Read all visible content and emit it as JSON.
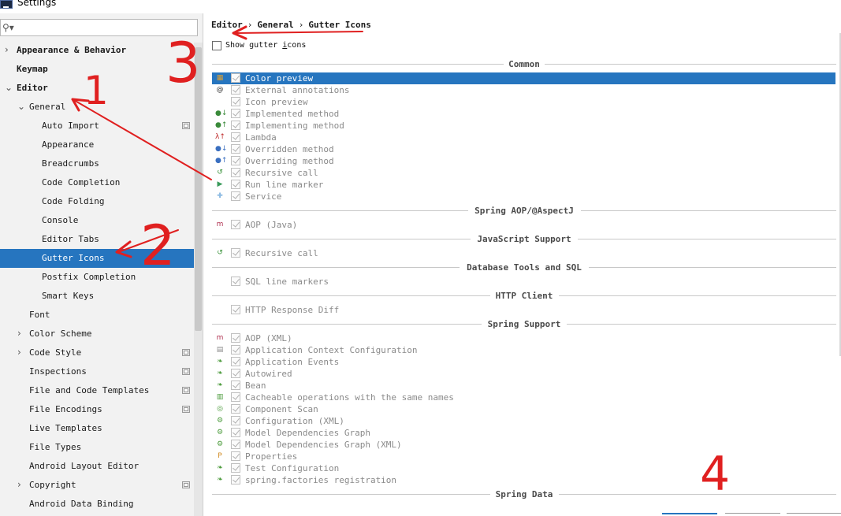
{
  "window": {
    "title": "Settings"
  },
  "search": {
    "placeholder": "",
    "value": ""
  },
  "tree": [
    {
      "label": "Appearance & Behavior",
      "bold": true,
      "arrow": "right",
      "level": 0
    },
    {
      "label": "Keymap",
      "bold": true,
      "arrow": "",
      "level": 0
    },
    {
      "label": "Editor",
      "bold": true,
      "arrow": "down",
      "level": 0
    },
    {
      "label": "General",
      "bold": false,
      "arrow": "down",
      "level": 1
    },
    {
      "label": "Auto Import",
      "bold": false,
      "arrow": "",
      "level": 2,
      "project_icon": true
    },
    {
      "label": "Appearance",
      "bold": false,
      "arrow": "",
      "level": 2
    },
    {
      "label": "Breadcrumbs",
      "bold": false,
      "arrow": "",
      "level": 2
    },
    {
      "label": "Code Completion",
      "bold": false,
      "arrow": "",
      "level": 2
    },
    {
      "label": "Code Folding",
      "bold": false,
      "arrow": "",
      "level": 2
    },
    {
      "label": "Console",
      "bold": false,
      "arrow": "",
      "level": 2
    },
    {
      "label": "Editor Tabs",
      "bold": false,
      "arrow": "",
      "level": 2
    },
    {
      "label": "Gutter Icons",
      "bold": false,
      "arrow": "",
      "level": 2,
      "selected": true
    },
    {
      "label": "Postfix Completion",
      "bold": false,
      "arrow": "",
      "level": 2
    },
    {
      "label": "Smart Keys",
      "bold": false,
      "arrow": "",
      "level": 2
    },
    {
      "label": "Font",
      "bold": false,
      "arrow": "",
      "level": 1
    },
    {
      "label": "Color Scheme",
      "bold": false,
      "arrow": "right",
      "level": 1
    },
    {
      "label": "Code Style",
      "bold": false,
      "arrow": "right",
      "level": 1,
      "project_icon": true
    },
    {
      "label": "Inspections",
      "bold": false,
      "arrow": "",
      "level": 1,
      "project_icon": true
    },
    {
      "label": "File and Code Templates",
      "bold": false,
      "arrow": "",
      "level": 1,
      "project_icon": true
    },
    {
      "label": "File Encodings",
      "bold": false,
      "arrow": "",
      "level": 1,
      "project_icon": true
    },
    {
      "label": "Live Templates",
      "bold": false,
      "arrow": "",
      "level": 1
    },
    {
      "label": "File Types",
      "bold": false,
      "arrow": "",
      "level": 1
    },
    {
      "label": "Android Layout Editor",
      "bold": false,
      "arrow": "",
      "level": 1
    },
    {
      "label": "Copyright",
      "bold": false,
      "arrow": "right",
      "level": 1,
      "project_icon": true
    },
    {
      "label": "Android Data Binding",
      "bold": false,
      "arrow": "",
      "level": 1
    }
  ],
  "breadcrumb": [
    "Editor",
    "General",
    "Gutter Icons"
  ],
  "breadcrumb_separator": "›",
  "show_gutter": {
    "label_pre": "Show gutter ",
    "label_mnemonic": "i",
    "label_post": "cons",
    "checked": false
  },
  "sections": [
    {
      "title": "Common",
      "items": [
        {
          "label": "Color preview",
          "icon": "color-preview-icon",
          "glyph": "▦",
          "color": "#e0a030",
          "selected": true
        },
        {
          "label": "External annotations",
          "icon": "at-sign-icon",
          "glyph": "@",
          "color": "#333333"
        },
        {
          "label": "Icon preview",
          "icon": "",
          "glyph": "",
          "color": ""
        },
        {
          "label": "Implemented method",
          "icon": "implemented-method-icon",
          "glyph": "●↓",
          "color": "#3a8a3a"
        },
        {
          "label": "Implementing method",
          "icon": "implementing-method-icon",
          "glyph": "●↑",
          "color": "#3a8a3a"
        },
        {
          "label": "Lambda",
          "icon": "lambda-icon",
          "glyph": "λ↑",
          "color": "#c03030"
        },
        {
          "label": "Overridden method",
          "icon": "overridden-method-icon",
          "glyph": "●↓",
          "color": "#3a6fc0"
        },
        {
          "label": "Overriding method",
          "icon": "overriding-method-icon",
          "glyph": "●↑",
          "color": "#3a6fc0"
        },
        {
          "label": "Recursive call",
          "icon": "recursive-call-icon",
          "glyph": "↺",
          "color": "#2d8a2d"
        },
        {
          "label": "Run line marker",
          "icon": "run-triangle-icon",
          "glyph": "▶",
          "color": "#3a9a5a"
        },
        {
          "label": "Service",
          "icon": "service-icon",
          "glyph": "✛",
          "color": "#2a7fc9"
        }
      ]
    },
    {
      "title": "Spring AOP/@AspectJ",
      "items": [
        {
          "label": "AOP (Java)",
          "icon": "aop-m-icon",
          "glyph": "m",
          "color": "#b03050"
        }
      ]
    },
    {
      "title": "JavaScript Support",
      "items": [
        {
          "label": "Recursive call",
          "icon": "recursive-call-icon",
          "glyph": "↺",
          "color": "#2d8a2d"
        }
      ]
    },
    {
      "title": "Database Tools and SQL",
      "items": [
        {
          "label": "SQL line markers",
          "icon": "",
          "glyph": "",
          "color": ""
        }
      ]
    },
    {
      "title": "HTTP Client",
      "items": [
        {
          "label": "HTTP Response Diff",
          "icon": "",
          "glyph": "",
          "color": ""
        }
      ]
    },
    {
      "title": "Spring Support",
      "items": [
        {
          "label": "AOP (XML)",
          "icon": "aop-m-icon",
          "glyph": "m",
          "color": "#b03050"
        },
        {
          "label": "Application Context Configuration",
          "icon": "context-config-icon",
          "glyph": "▤",
          "color": "#8a8a8a"
        },
        {
          "label": "Application Events",
          "icon": "spring-leaf-icon",
          "glyph": "❧",
          "color": "#4a9a3a"
        },
        {
          "label": "Autowired",
          "icon": "spring-leaf-icon",
          "glyph": "❧",
          "color": "#4a9a3a"
        },
        {
          "label": "Bean",
          "icon": "spring-leaf-icon",
          "glyph": "❧",
          "color": "#4a9a3a"
        },
        {
          "label": "Cacheable operations with the same names",
          "icon": "cacheable-icon",
          "glyph": "▥",
          "color": "#4a9a3a"
        },
        {
          "label": "Component Scan",
          "icon": "component-scan-icon",
          "glyph": "◎",
          "color": "#4a9a3a"
        },
        {
          "label": "Configuration (XML)",
          "icon": "configuration-xml-icon",
          "glyph": "⚙",
          "color": "#4a9a3a"
        },
        {
          "label": "Model Dependencies Graph",
          "icon": "graph-icon",
          "glyph": "⚙",
          "color": "#4a9a3a"
        },
        {
          "label": "Model Dependencies Graph (XML)",
          "icon": "graph-xml-icon",
          "glyph": "⚙",
          "color": "#4a9a3a"
        },
        {
          "label": "Properties",
          "icon": "properties-icon",
          "glyph": "P",
          "color": "#d08a20"
        },
        {
          "label": "Test Configuration",
          "icon": "spring-leaf-icon",
          "glyph": "❧",
          "color": "#4a9a3a"
        },
        {
          "label": "spring.factories registration",
          "icon": "spring-factories-icon",
          "glyph": "❧",
          "color": "#4a9a3a"
        }
      ]
    },
    {
      "title": "Spring Data",
      "items": []
    }
  ],
  "annotations": [
    {
      "text": "1",
      "color": "#e02020"
    },
    {
      "text": "2",
      "color": "#e02020"
    },
    {
      "text": "3",
      "color": "#e02020"
    },
    {
      "text": "4",
      "color": "#e02020"
    }
  ],
  "colors": {
    "selection": "#2675bf",
    "annotation": "#e02020"
  }
}
